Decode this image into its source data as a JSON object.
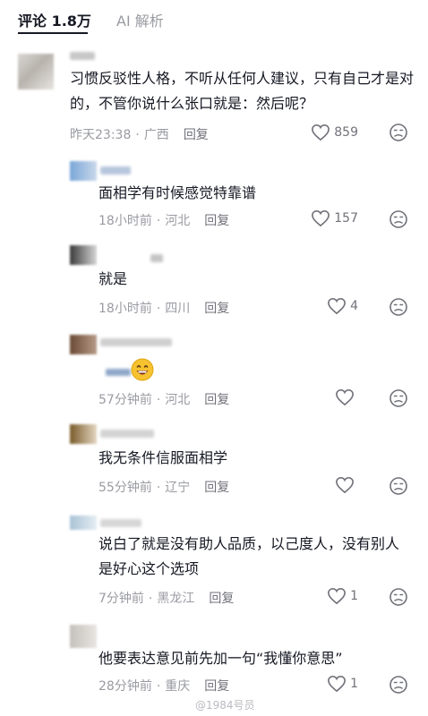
{
  "tabs": {
    "comments": "评论 1.8万",
    "ai": "AI 解析"
  },
  "comments": [
    {
      "text": "习惯反驳性人格，不听从任何人建议，只有自己才是对的，不管你说什么张口就是：然后呢？",
      "time": "昨天23:38",
      "location": "广西",
      "reply": "回复",
      "likes": "859"
    },
    {
      "text": "面相学有时候感觉特靠谱",
      "time": "18小时前",
      "location": "河北",
      "reply": "回复",
      "likes": "157"
    },
    {
      "text": "就是",
      "time": "18小时前",
      "location": "四川",
      "reply": "回复",
      "likes": "4"
    },
    {
      "text": "",
      "time": "57分钟前",
      "location": "河北",
      "reply": "回复",
      "likes": "",
      "emoji": "grinning-face-emoji"
    },
    {
      "text": "我无条件信服面相学",
      "time": "55分钟前",
      "location": "辽宁",
      "reply": "回复",
      "likes": ""
    },
    {
      "text": "说白了就是没有助人品质，以己度人，没有别人是好心这个选项",
      "time": "7分钟前",
      "location": "黑龙江",
      "reply": "回复",
      "likes": "1"
    },
    {
      "text": "他要表达意见前先加一句“我懂你意思”",
      "time": "28分钟前",
      "location": "重庆",
      "reply": "回复",
      "likes": "1"
    }
  ],
  "meta_separator": "·",
  "watermark": "@1984号员",
  "colors": {
    "primary_text": "#161823",
    "secondary_text": "#9a9ba2",
    "icon": "#71727a",
    "emoji": "#f7c22f"
  }
}
